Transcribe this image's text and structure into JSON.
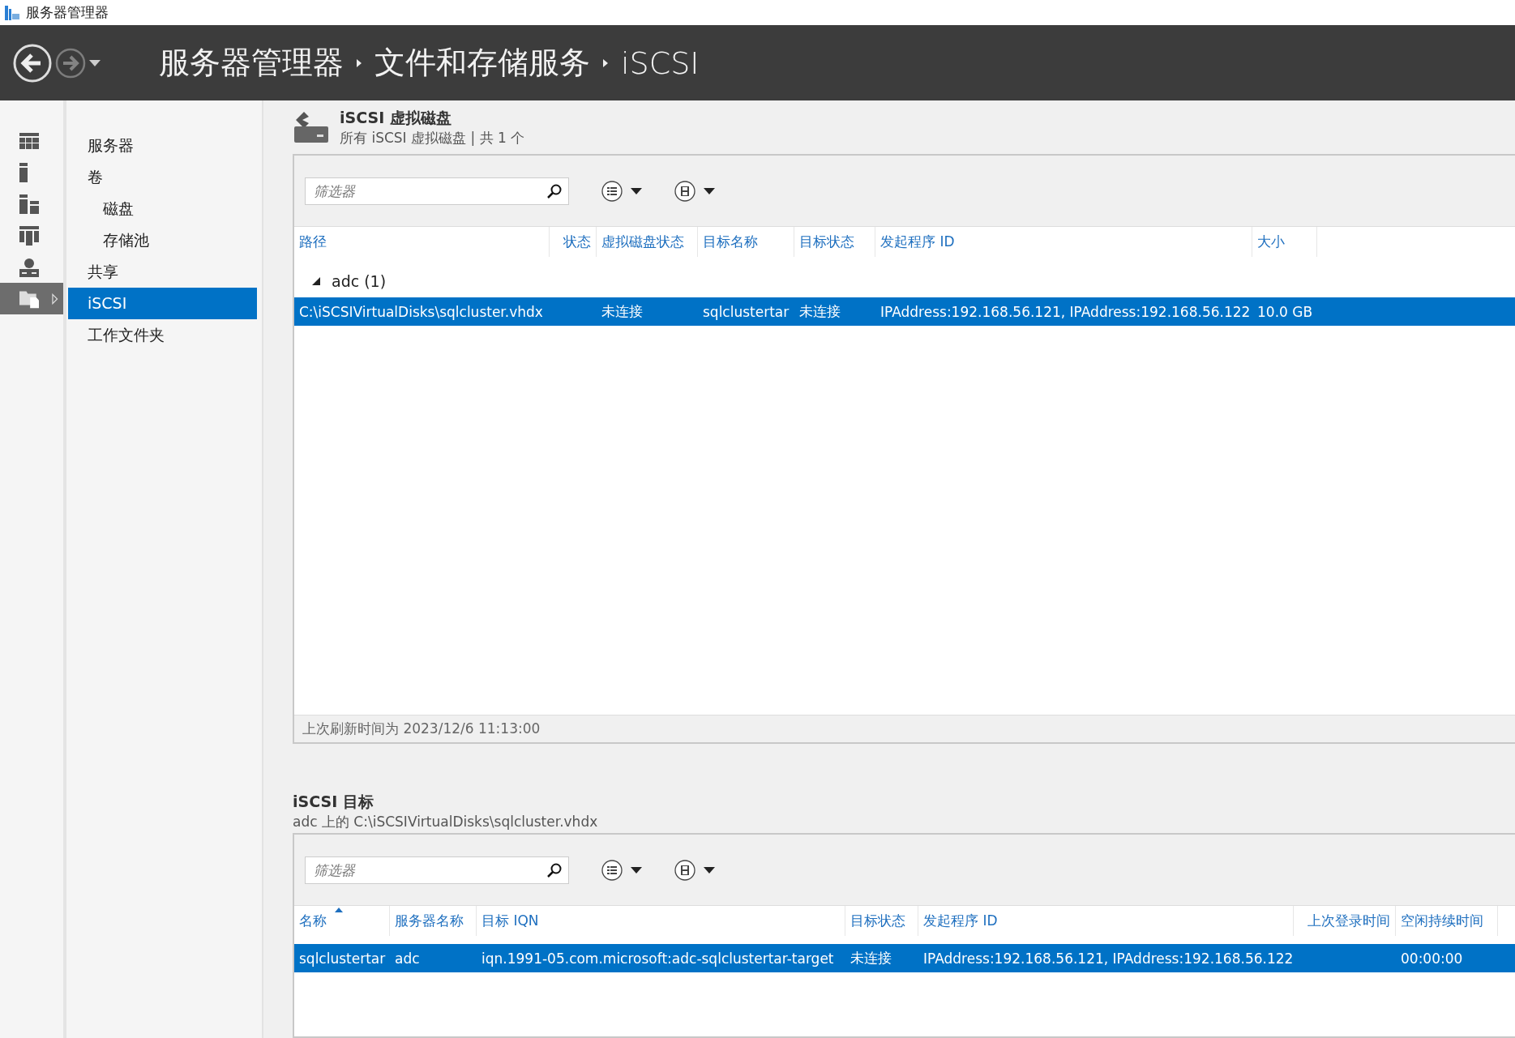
{
  "window": {
    "title": "服务器管理器"
  },
  "nav": {
    "back_disabled": false,
    "forward_disabled": true
  },
  "breadcrumb": [
    "服务器管理器",
    "文件和存储服务",
    "iSCSI"
  ],
  "rail": [
    {
      "kind": "dashboard",
      "selected": false
    },
    {
      "kind": "server",
      "selected": false
    },
    {
      "kind": "all-servers",
      "selected": false
    },
    {
      "kind": "cluster",
      "selected": false
    },
    {
      "kind": "network",
      "selected": false
    },
    {
      "kind": "storage",
      "selected": true,
      "expandable": true
    }
  ],
  "sidebar": {
    "items": [
      {
        "label": "服务器",
        "selected": false
      },
      {
        "label": "卷",
        "selected": false,
        "children": [
          {
            "label": "磁盘",
            "selected": false
          },
          {
            "label": "存储池",
            "selected": false
          }
        ]
      },
      {
        "label": "共享",
        "selected": false
      },
      {
        "label": "iSCSI",
        "selected": true
      },
      {
        "label": "工作文件夹",
        "selected": false
      }
    ]
  },
  "virtual_disks": {
    "title": "iSCSI 虚拟磁盘",
    "subtitle": "所有 iSCSI 虚拟磁盘 | 共 1 个",
    "filter": {
      "placeholder": "筛选器"
    },
    "columns": [
      {
        "label": "路径"
      },
      {
        "label": "状态"
      },
      {
        "label": "虚拟磁盘状态"
      },
      {
        "label": "目标名称"
      },
      {
        "label": "目标状态"
      },
      {
        "label": "发起程序 ID"
      },
      {
        "label": "大小"
      }
    ],
    "groups": [
      {
        "label": "adc (1)",
        "expanded": true,
        "rows": [
          {
            "selected": true,
            "cells": [
              "C:\\iSCSIVirtualDisks\\sqlcluster.vhdx",
              null,
              "未连接",
              "sqlclustertar",
              "未连接",
              "IPAddress:192.168.56.121, IPAddress:192.168.56.122",
              "10.0 GB"
            ]
          }
        ]
      }
    ],
    "footer": "上次刷新时间为 2023/12/6 11:13:00"
  },
  "targets": {
    "title": "iSCSI 目标",
    "subtitle": "adc 上的 C:\\iSCSIVirtualDisks\\sqlcluster.vhdx",
    "filter": {
      "placeholder": "筛选器"
    },
    "columns": [
      {
        "label": "名称",
        "sorted": true
      },
      {
        "label": "服务器名称",
        "sorted": false
      },
      {
        "label": "目标 IQN",
        "sorted": false
      },
      {
        "label": "目标状态",
        "sorted": false
      },
      {
        "label": "发起程序 ID",
        "sorted": false
      },
      {
        "label": "上次登录时间",
        "sorted": false
      },
      {
        "label": "空闲持续时间",
        "sorted": false
      }
    ],
    "rows": [
      {
        "selected": true,
        "cells": [
          "sqlclustertar",
          "adc",
          "iqn.1991-05.com.microsoft:adc-sqlclustertar-target",
          "未连接",
          "IPAddress:192.168.56.121, IPAddress:192.168.56.122",
          null,
          "00:00:00"
        ]
      }
    ]
  }
}
